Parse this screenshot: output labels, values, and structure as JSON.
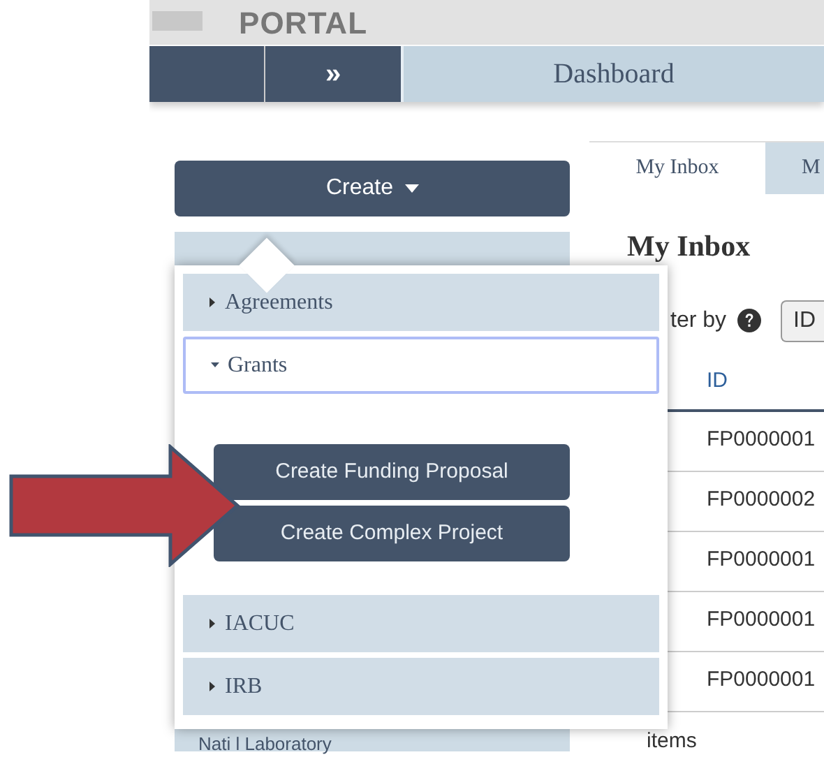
{
  "header": {
    "portal_text": "PORTAL"
  },
  "nav": {
    "expand_glyph": "»",
    "title": "Dashboard"
  },
  "create_button": {
    "label": "Create"
  },
  "sidebar": {
    "footer_text": "Nati  l Laboratory"
  },
  "tabs": [
    {
      "label": "My Inbox",
      "selected": true
    },
    {
      "label": "M",
      "selected": false
    }
  ],
  "inbox": {
    "heading": "My Inbox",
    "filter_label": "ter by",
    "filter_value": "ID",
    "column": "ID",
    "rows": [
      "FP0000001",
      "FP0000002",
      "FP0000001",
      "FP0000001",
      "FP0000001"
    ],
    "count_text": "items"
  },
  "create_menu": [
    {
      "label": "Agreements",
      "expanded": false,
      "focused": false
    },
    {
      "label": "Grants",
      "expanded": true,
      "focused": true,
      "actions": [
        "Create Funding Proposal",
        "Create Complex Project"
      ]
    },
    {
      "label": "IACUC",
      "expanded": false,
      "focused": false
    },
    {
      "label": "IRB",
      "expanded": false,
      "focused": false
    }
  ]
}
